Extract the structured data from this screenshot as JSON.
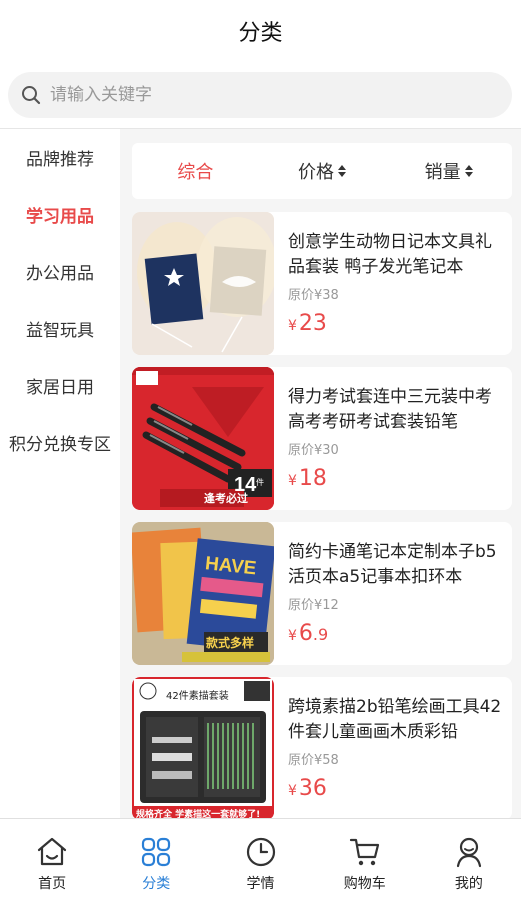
{
  "header": {
    "title": "分类"
  },
  "search": {
    "placeholder": "请输入关键字"
  },
  "sidebar": {
    "items": [
      {
        "label": "品牌推荐",
        "active": false
      },
      {
        "label": "学习用品",
        "active": true
      },
      {
        "label": "办公用品",
        "active": false
      },
      {
        "label": "益智玩具",
        "active": false
      },
      {
        "label": "家居日用",
        "active": false
      },
      {
        "label": "积分兑换专区",
        "active": false
      }
    ]
  },
  "sortbar": {
    "items": [
      {
        "label": "综合",
        "active": true
      },
      {
        "label": "价格",
        "active": false
      },
      {
        "label": "销量",
        "active": false
      }
    ]
  },
  "products": [
    {
      "name": "创意学生动物日记本文具礼品套装 鸭子发光笔记本",
      "orig_price": "原价¥38",
      "currency": "¥",
      "price_int": "23",
      "price_dec": ""
    },
    {
      "name": "得力考试套连中三元装中考高考考研考试套装铅笔",
      "orig_price": "原价¥30",
      "currency": "¥",
      "price_int": "18",
      "price_dec": ""
    },
    {
      "name": "简约卡通笔记本定制本子b5活页本a5记事本扣环本",
      "orig_price": "原价¥12",
      "currency": "¥",
      "price_int": "6",
      "price_dec": ".9"
    },
    {
      "name": "跨境素描2b铅笔绘画工具42件套儿童画画木质彩铅",
      "orig_price": "原价¥58",
      "currency": "¥",
      "price_int": "36",
      "price_dec": ""
    }
  ],
  "product_image_text": {
    "p2_count": "14",
    "p2_unit": "件",
    "p2_slogan": "逢考必过",
    "p3_slogan": "款式多样",
    "p3_cover": "HAVE",
    "p4_title": "42件素描套装",
    "p4_footer": "规格齐全 学素描这一套就够了!"
  },
  "tabbar": {
    "items": [
      {
        "label": "首页",
        "icon": "home-icon",
        "active": false
      },
      {
        "label": "分类",
        "icon": "category-icon",
        "active": true
      },
      {
        "label": "学情",
        "icon": "clock-icon",
        "active": false
      },
      {
        "label": "购物车",
        "icon": "cart-icon",
        "active": false
      },
      {
        "label": "我的",
        "icon": "user-icon",
        "active": false
      }
    ]
  },
  "colors": {
    "accent": "#e84a4a",
    "tab_active": "#2a7fd6",
    "content_bg": "#f5f5f5"
  }
}
